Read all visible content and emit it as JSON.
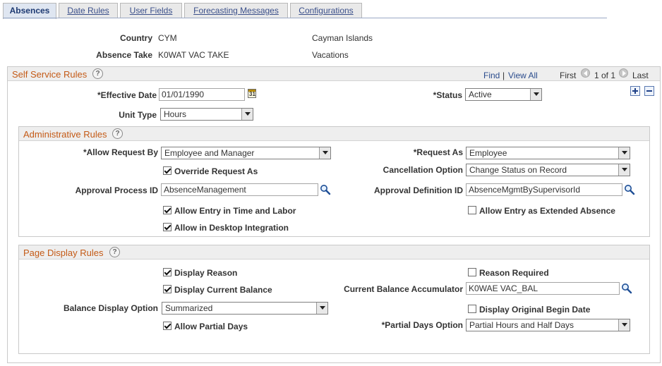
{
  "tabs": [
    "Absences",
    "Date Rules",
    "User Fields",
    "Forecasting Messages",
    "Configurations"
  ],
  "header": {
    "country_label": "Country",
    "country_code": "CYM",
    "country_name": "Cayman Islands",
    "absence_take_label": "Absence Take",
    "absence_take_code": "K0WAT VAC TAKE",
    "absence_take_name": "Vacations"
  },
  "self_service": {
    "title": "Self Service Rules",
    "help_icon": "?",
    "find": "Find",
    "separator": "|",
    "view_all": "View All",
    "first": "First",
    "pager": "1 of 1",
    "last": "Last",
    "effective_date_label": "*Effective Date",
    "effective_date": "01/01/1990",
    "calendar_glyph": "31",
    "status_label": "*Status",
    "status": "Active",
    "unit_type_label": "Unit Type",
    "unit_type": "Hours"
  },
  "admin": {
    "title": "Administrative Rules",
    "allow_request_by_label": "*Allow Request By",
    "allow_request_by": "Employee and Manager",
    "request_as_label": "*Request As",
    "request_as": "Employee",
    "override_request_as": "Override Request As",
    "override_request_as_checked": true,
    "cancellation_label": "Cancellation Option",
    "cancellation": "Change Status on Record",
    "approval_process_label": "Approval Process ID",
    "approval_process": "AbsenceManagement",
    "approval_definition_label": "Approval Definition ID",
    "approval_definition": "AbsenceMgmtBySupervisorId",
    "allow_entry_tl": "Allow Entry in Time and Labor",
    "allow_entry_tl_checked": true,
    "allow_extended": "Allow Entry as Extended Absence",
    "allow_extended_checked": false,
    "allow_desktop": "Allow in Desktop Integration",
    "allow_desktop_checked": true
  },
  "display": {
    "title": "Page Display Rules",
    "display_reason": "Display Reason",
    "display_reason_checked": true,
    "reason_required": "Reason Required",
    "reason_required_checked": false,
    "display_balance": "Display Current Balance",
    "display_balance_checked": true,
    "accumulator_label": "Current Balance Accumulator",
    "accumulator": "K0WAE VAC_BAL",
    "balance_option_label": "Balance Display Option",
    "balance_option": "Summarized",
    "display_original": "Display Original Begin Date",
    "display_original_checked": false,
    "allow_partial": "Allow Partial Days",
    "allow_partial_checked": true,
    "partial_option_label": "*Partial Days Option",
    "partial_option": "Partial Hours and Half Days"
  },
  "colors": {
    "section_title": "#c45a16",
    "link": "#2b4c8d",
    "active_tab": "#dfe6f1"
  }
}
